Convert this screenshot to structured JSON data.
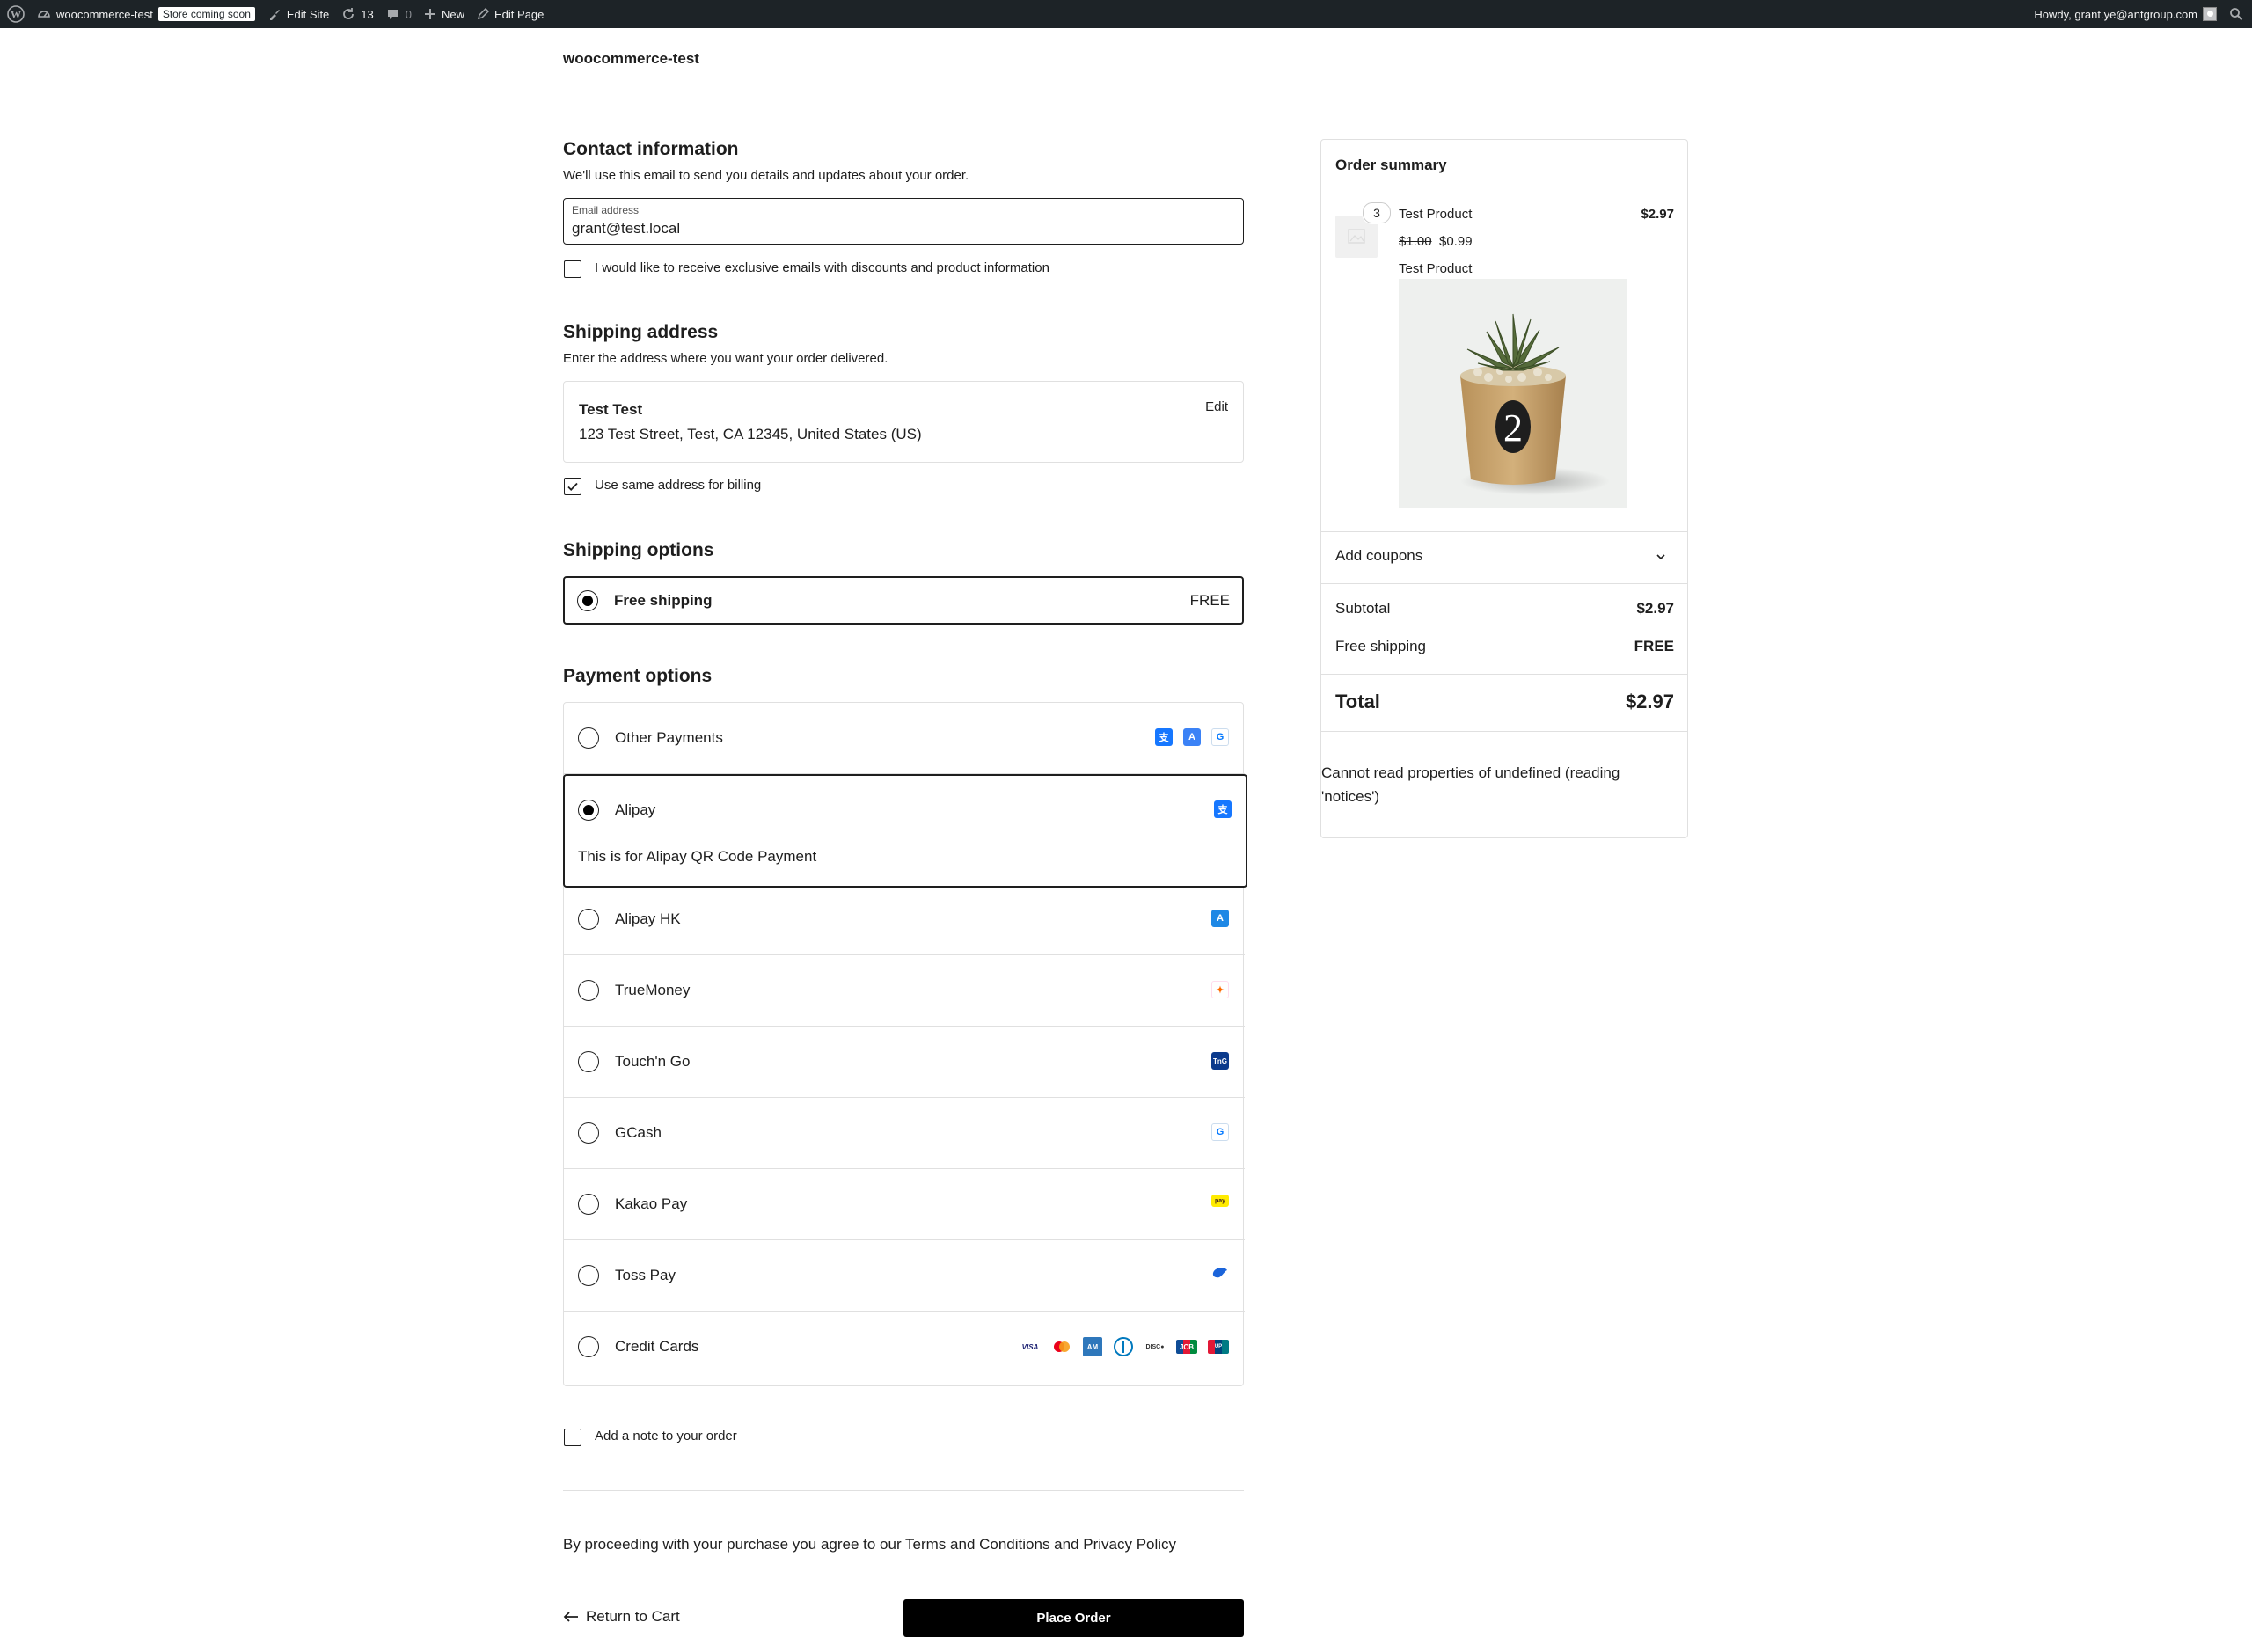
{
  "admin_bar": {
    "site_name": "woocommerce-test",
    "store_badge": "Store coming soon",
    "edit_site": "Edit Site",
    "updates_count": "13",
    "comments_count": "0",
    "new_label": "New",
    "edit_page": "Edit Page",
    "greeting": "Howdy, grant.ye@antgroup.com"
  },
  "site_title": "woocommerce-test",
  "contact": {
    "heading": "Contact information",
    "description": "We'll use this email to send you details and updates about your order.",
    "email_label": "Email address",
    "email_value": "grant@test.local",
    "marketing_optin": "I would like to receive exclusive emails with discounts and product information",
    "marketing_checked": false
  },
  "shipping": {
    "heading": "Shipping address",
    "description": "Enter the address where you want your order delivered.",
    "name": "Test Test",
    "address": "123 Test Street, Test, CA 12345, United States (US)",
    "edit_label": "Edit",
    "same_billing_label": "Use same address for billing",
    "same_billing_checked": true
  },
  "shipping_options": {
    "heading": "Shipping options",
    "option_name": "Free shipping",
    "option_price": "FREE",
    "selected": true
  },
  "payment": {
    "heading": "Payment options",
    "methods": [
      {
        "name": "Other Payments",
        "selected": false
      },
      {
        "name": "Alipay",
        "selected": true,
        "description": "This is for Alipay QR Code Payment"
      },
      {
        "name": "Alipay HK",
        "selected": false
      },
      {
        "name": "TrueMoney",
        "selected": false
      },
      {
        "name": "Touch'n Go",
        "selected": false
      },
      {
        "name": "GCash",
        "selected": false
      },
      {
        "name": "Kakao Pay",
        "selected": false
      },
      {
        "name": "Toss Pay",
        "selected": false
      },
      {
        "name": "Credit Cards",
        "selected": false
      }
    ],
    "card_brands": [
      "VISA",
      "mastercard",
      "amex",
      "diners",
      "discover",
      "jcb",
      "unionpay"
    ]
  },
  "order_note": {
    "label": "Add a note to your order",
    "checked": false
  },
  "terms": "By proceeding with your purchase you agree to our Terms and Conditions and Privacy Policy",
  "actions": {
    "return_label": "Return to Cart",
    "place_order_label": "Place Order"
  },
  "summary": {
    "heading": "Order summary",
    "item": {
      "quantity": "3",
      "name": "Test Product",
      "line_total": "$2.97",
      "regular_price": "$1.00",
      "sale_price": "$0.99",
      "description": "Test Product",
      "image_caption": "2"
    },
    "coupons_label": "Add coupons",
    "subtotal_label": "Subtotal",
    "subtotal_value": "$2.97",
    "shipping_label": "Free shipping",
    "shipping_value": "FREE",
    "total_label": "Total",
    "total_value": "$2.97",
    "error": "Cannot read properties of undefined (reading 'notices')"
  },
  "colors": {
    "admin_bar": "#1d2327",
    "text": "#1e1e1e",
    "border": "#e0e0e0",
    "button": "#000000",
    "alipay_blue": "#1677ff"
  }
}
